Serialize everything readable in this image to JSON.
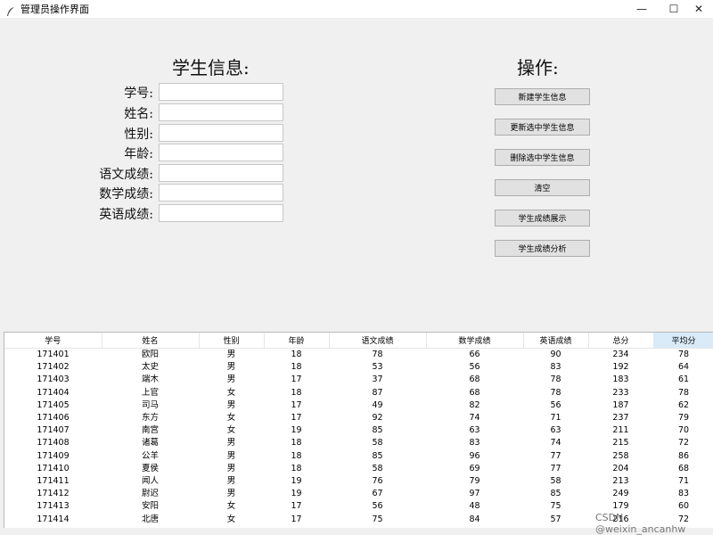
{
  "window": {
    "title": "管理员操作界面",
    "controls": {
      "minimize": "—",
      "maximize": "☐",
      "close": "✕"
    }
  },
  "form": {
    "heading": "学生信息:",
    "fields": [
      {
        "label": "学号:",
        "value": ""
      },
      {
        "label": "姓名:",
        "value": ""
      },
      {
        "label": "性别:",
        "value": ""
      },
      {
        "label": "年龄:",
        "value": ""
      },
      {
        "label": "语文成绩:",
        "value": ""
      },
      {
        "label": "数学成绩:",
        "value": ""
      },
      {
        "label": "英语成绩:",
        "value": ""
      }
    ]
  },
  "operations": {
    "heading": "操作:",
    "buttons": [
      "新建学生信息",
      "更新选中学生信息",
      "删除选中学生信息",
      "清空",
      "学生成绩展示",
      "学生成绩分析"
    ]
  },
  "table": {
    "sorted_column": 8,
    "columns": [
      "学号",
      "姓名",
      "性别",
      "年龄",
      "语文成绩",
      "数学成绩",
      "英语成绩",
      "总分",
      "平均分"
    ],
    "rows": [
      [
        "171401",
        "欧阳",
        "男",
        "18",
        "78",
        "66",
        "90",
        "234",
        "78"
      ],
      [
        "171402",
        "太史",
        "男",
        "18",
        "53",
        "56",
        "83",
        "192",
        "64"
      ],
      [
        "171403",
        "端木",
        "男",
        "17",
        "37",
        "68",
        "78",
        "183",
        "61"
      ],
      [
        "171404",
        "上官",
        "女",
        "18",
        "87",
        "68",
        "78",
        "233",
        "78"
      ],
      [
        "171405",
        "司马",
        "男",
        "17",
        "49",
        "82",
        "56",
        "187",
        "62"
      ],
      [
        "171406",
        "东方",
        "女",
        "17",
        "92",
        "74",
        "71",
        "237",
        "79"
      ],
      [
        "171407",
        "南宫",
        "女",
        "19",
        "85",
        "63",
        "63",
        "211",
        "70"
      ],
      [
        "171408",
        "诸葛",
        "男",
        "18",
        "58",
        "83",
        "74",
        "215",
        "72"
      ],
      [
        "171409",
        "公羊",
        "男",
        "18",
        "85",
        "96",
        "77",
        "258",
        "86"
      ],
      [
        "171410",
        "夏侯",
        "男",
        "18",
        "58",
        "69",
        "77",
        "204",
        "68"
      ],
      [
        "171411",
        "闻人",
        "男",
        "19",
        "76",
        "79",
        "58",
        "213",
        "71"
      ],
      [
        "171412",
        "尉迟",
        "男",
        "19",
        "67",
        "97",
        "85",
        "249",
        "83"
      ],
      [
        "171413",
        "安阳",
        "女",
        "17",
        "56",
        "48",
        "75",
        "179",
        "60"
      ],
      [
        "171414",
        "北唐",
        "女",
        "17",
        "75",
        "84",
        "57",
        "216",
        "72"
      ]
    ]
  },
  "watermark": "CSDN @weixin_ancanhw"
}
